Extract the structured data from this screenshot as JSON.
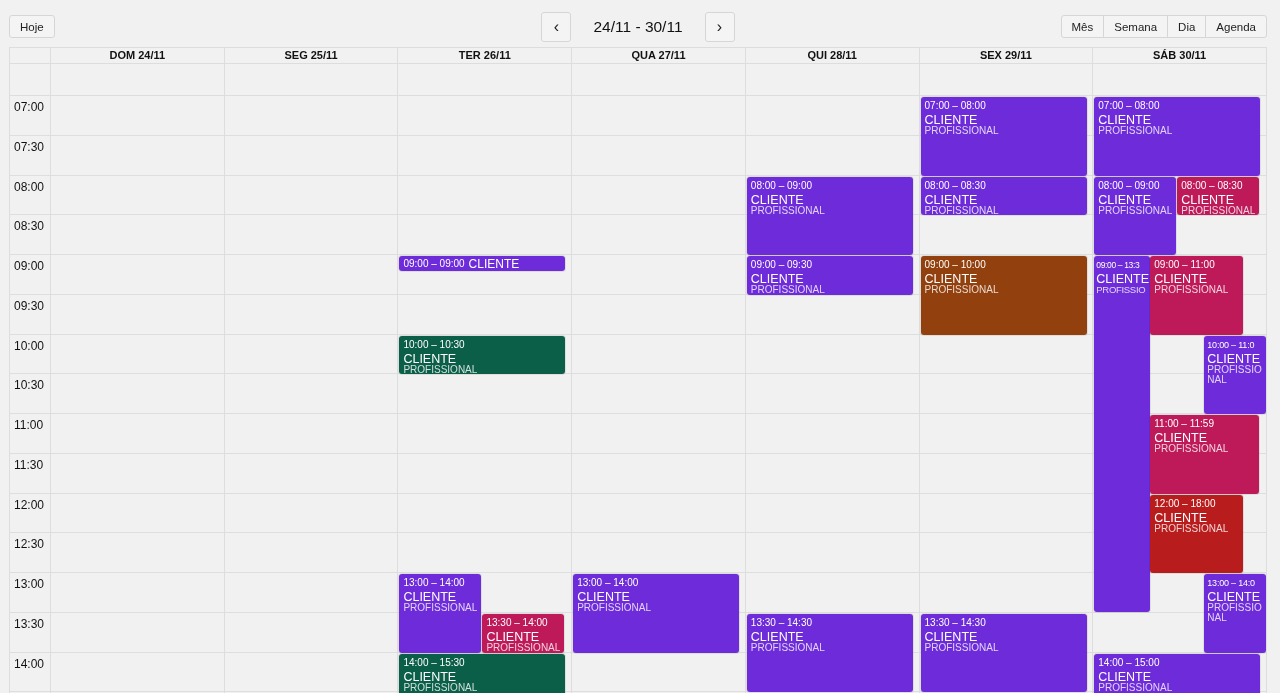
{
  "toolbar": {
    "today_button": "Hoje",
    "range_title": "24/11 - 30/11",
    "prev_button": "‹",
    "next_button": "›",
    "views": [
      "Mês",
      "Semana",
      "Dia",
      "Agenda"
    ]
  },
  "time_labels": [
    "07:00",
    "07:30",
    "08:00",
    "08:30",
    "09:00",
    "09:30",
    "10:00",
    "10:30",
    "11:00",
    "11:30",
    "12:00",
    "12:30",
    "13:00",
    "13:30",
    "14:00"
  ],
  "days": [
    {
      "label": "DOM 24/11"
    },
    {
      "label": "SEG 25/11"
    },
    {
      "label": "TER 26/11",
      "events": [
        {
          "kind": "compact",
          "time": "09:00 – 09:00",
          "title": "CLIENTE",
          "color": "#6d2bd9"
        },
        {
          "kind": "block",
          "time": "10:00 – 10:30",
          "title": "CLIENTE",
          "subtitle": "PROFISSIONAL",
          "color": "#0b5e48"
        },
        {
          "kind": "block",
          "time": "13:00 – 14:00",
          "title": "CLIENTE",
          "subtitle": "PROFISSIONAL",
          "color": "#6d2bd9"
        },
        {
          "kind": "block",
          "time": "13:30 – 14:00",
          "title": "CLIENTE",
          "subtitle": "PROFISSIONAL",
          "color": "#be1a5a"
        },
        {
          "kind": "block",
          "time": "14:00 – 15:30",
          "title": "CLIENTE",
          "subtitle": "PROFISSIONAL",
          "color": "#0b5e48"
        }
      ]
    },
    {
      "label": "QUA 27/11",
      "events": [
        {
          "kind": "block",
          "time": "13:00 – 14:00",
          "title": "CLIENTE",
          "subtitle": "PROFISSIONAL",
          "color": "#6d2bd9"
        }
      ]
    },
    {
      "label": "QUI 28/11",
      "events": [
        {
          "kind": "block",
          "time": "08:00 – 09:00",
          "title": "CLIENTE",
          "subtitle": "PROFISSIONAL",
          "color": "#6d2bd9"
        },
        {
          "kind": "block",
          "time": "09:00 – 09:30",
          "title": "CLIENTE",
          "subtitle": "PROFISSIONAL",
          "color": "#6d2bd9"
        },
        {
          "kind": "block",
          "time": "13:30 – 14:30",
          "title": "CLIENTE",
          "subtitle": "PROFISSIONAL",
          "color": "#6d2bd9"
        }
      ]
    },
    {
      "label": "SEX 29/11",
      "events": [
        {
          "kind": "block",
          "time": "07:00 – 08:00",
          "title": "CLIENTE",
          "subtitle": "PROFISSIONAL",
          "color": "#6d2bd9"
        },
        {
          "kind": "block",
          "time": "08:00 – 08:30",
          "title": "CLIENTE",
          "subtitle": "PROFISSIONAL",
          "color": "#6d2bd9"
        },
        {
          "kind": "block",
          "time": "09:00 – 10:00",
          "title": "CLIENTE",
          "subtitle": "PROFISSIONAL",
          "color": "#92400e"
        },
        {
          "kind": "block",
          "time": "13:30 – 14:30",
          "title": "CLIENTE",
          "subtitle": "PROFISSIONAL",
          "color": "#6d2bd9"
        }
      ]
    },
    {
      "label": "SÁB 30/11",
      "events": [
        {
          "kind": "block",
          "time": "07:00 – 08:00",
          "title": "CLIENTE",
          "subtitle": "PROFISSIONAL",
          "color": "#6d2bd9"
        },
        {
          "kind": "block",
          "time": "08:00 – 09:00",
          "title": "CLIENTE",
          "subtitle": "PROFISSIONAL",
          "color": "#6d2bd9"
        },
        {
          "kind": "block",
          "time": "08:00 – 08:30",
          "title": "CLIENTE",
          "subtitle": "PROFISSIONAL",
          "color": "#be1a5a"
        },
        {
          "kind": "block",
          "time": "09:00 – 13:3",
          "title": "CLIENTE",
          "subtitle": "PROFISSIO",
          "color": "#6d2bd9"
        },
        {
          "kind": "block",
          "time": "09:00 – 11:00",
          "title": "CLIENTE",
          "subtitle": "PROFISSIONAL",
          "color": "#be1a5a"
        },
        {
          "kind": "block",
          "time": "10:00 – 11:0",
          "title": "CLIENTE",
          "subtitle": "PROFISSIONAL",
          "color": "#6d2bd9"
        },
        {
          "kind": "block",
          "time": "11:00 – 11:59",
          "title": "CLIENTE",
          "subtitle": "PROFISSIONAL",
          "color": "#be1a5a"
        },
        {
          "kind": "block",
          "time": "12:00 – 18:00",
          "title": "CLIENTE",
          "subtitle": "PROFISSIONAL",
          "color": "#b91c1c"
        },
        {
          "kind": "block",
          "time": "13:00 – 14:0",
          "title": "CLIENTE",
          "subtitle": "PROFISSIONAL",
          "color": "#6d2bd9"
        },
        {
          "kind": "block",
          "time": "14:00 – 15:00",
          "title": "CLIENTE",
          "subtitle": "PROFISSIONAL",
          "color": "#6d2bd9"
        }
      ]
    }
  ]
}
